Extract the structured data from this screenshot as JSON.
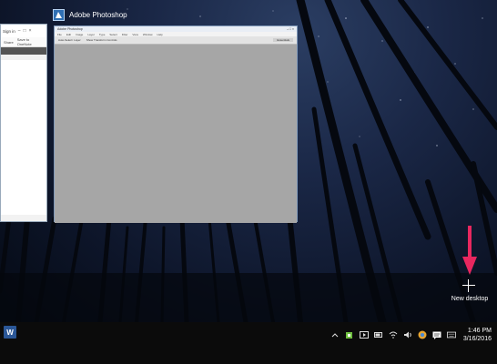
{
  "colors": {
    "taskbar": "#0b0b0b",
    "arrow": "#e8275f",
    "ps_blue": "#2f6fb3"
  },
  "left_window": {
    "sign_in": "Sign in",
    "share": "Share",
    "save_to_onenote": "Save to OneNote"
  },
  "photoshop": {
    "app_label": "Adobe Photoshop",
    "window_title": "Adobe Photoshop",
    "menu": [
      "File",
      "Edit",
      "Image",
      "Layer",
      "Type",
      "Select",
      "Filter",
      "View",
      "Window",
      "Help"
    ],
    "options": [
      "Auto-Select: Layer",
      "Show Transform Controls",
      "Essentials"
    ]
  },
  "new_desktop": {
    "label": "New desktop"
  },
  "taskbar": {
    "time": "1:46 PM",
    "date": "3/16/2016",
    "tray_icons": [
      "chevron-up-icon",
      "app-icon",
      "video-icon",
      "battery-icon",
      "wifi-icon",
      "volume-icon",
      "chrome-icon",
      "notification-icon",
      "keyboard-icon"
    ]
  }
}
